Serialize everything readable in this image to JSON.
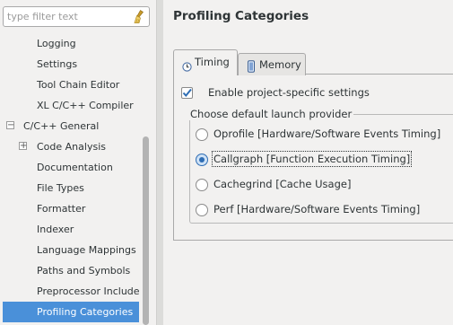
{
  "filter": {
    "placeholder": "type filter text",
    "value": ""
  },
  "tree": {
    "items": [
      {
        "label": "Logging",
        "level": 2,
        "expander": ""
      },
      {
        "label": "Settings",
        "level": 2,
        "expander": ""
      },
      {
        "label": "Tool Chain Editor",
        "level": 2,
        "expander": ""
      },
      {
        "label": "XL C/C++ Compiler",
        "level": 2,
        "expander": ""
      },
      {
        "label": "C/C++ General",
        "level": 1,
        "expander": "−"
      },
      {
        "label": "Code Analysis",
        "level": 2,
        "expander": "+"
      },
      {
        "label": "Documentation",
        "level": 2,
        "expander": ""
      },
      {
        "label": "File Types",
        "level": 2,
        "expander": ""
      },
      {
        "label": "Formatter",
        "level": 2,
        "expander": ""
      },
      {
        "label": "Indexer",
        "level": 2,
        "expander": ""
      },
      {
        "label": "Language Mappings",
        "level": 2,
        "expander": ""
      },
      {
        "label": "Paths and Symbols",
        "level": 2,
        "expander": ""
      },
      {
        "label": "Preprocessor Include Paths",
        "level": 2,
        "expander": ""
      },
      {
        "label": "Profiling Categories",
        "level": 2,
        "expander": "",
        "selected": true
      }
    ]
  },
  "main": {
    "title": "Profiling Categories",
    "tabs": [
      {
        "label": "Timing",
        "icon": "clock-icon",
        "active": true
      },
      {
        "label": "Memory",
        "icon": "memory-icon",
        "active": false
      }
    ],
    "enable_checkbox": {
      "label": "Enable project-specific settings",
      "checked": true
    },
    "group_title": "Choose default launch provider",
    "providers": [
      {
        "label": "Oprofile [Hardware/Software Events Timing]",
        "selected": false
      },
      {
        "label": "Callgraph [Function Execution Timing]",
        "selected": true
      },
      {
        "label": "Cachegrind [Cache Usage]",
        "selected": false
      },
      {
        "label": "Perf [Hardware/Software Events Timing]",
        "selected": false
      }
    ]
  },
  "colors": {
    "selection": "#4a90d9",
    "radio_accent": "#2e6db4",
    "check_accent": "#2e6db4"
  }
}
